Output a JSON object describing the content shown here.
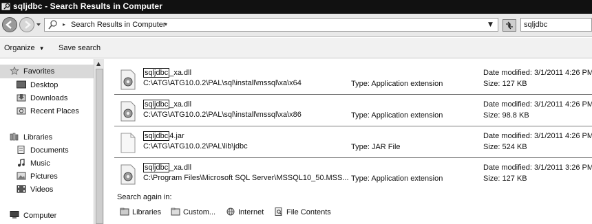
{
  "window": {
    "title": "sqljdbc - Search Results in Computer"
  },
  "address_bar": {
    "breadcrumb": "Search Results in Computer",
    "search_value": "sqljdbc"
  },
  "command_bar": {
    "organize_label": "Organize",
    "save_search_label": "Save search"
  },
  "navigation": {
    "favorites_label": "Favorites",
    "favorites_items": [
      "Desktop",
      "Downloads",
      "Recent Places"
    ],
    "libraries_label": "Libraries",
    "libraries_items": [
      "Documents",
      "Music",
      "Pictures",
      "Videos"
    ],
    "computer_label": "Computer"
  },
  "results": [
    {
      "name_match": "sqljdbc",
      "name_rest": "_xa.dll",
      "path": "C:\\ATG\\ATG10.0.2\\PAL\\sql\\install\\mssql\\xa\\x64",
      "type": "Type: Application extension",
      "date": "Date modified: 3/1/2011 4:26 PM",
      "size": "Size: 127 KB",
      "icon": "dll-gear-icon"
    },
    {
      "name_match": "sqljdbc",
      "name_rest": "_xa.dll",
      "path": "C:\\ATG\\ATG10.0.2\\PAL\\sql\\install\\mssql\\xa\\x86",
      "type": "Type: Application extension",
      "date": "Date modified: 3/1/2011 4:26 PM",
      "size": "Size: 98.8 KB",
      "icon": "dll-gear-icon"
    },
    {
      "name_match": "sqljdbc",
      "name_rest": "4.jar",
      "path": "C:\\ATG\\ATG10.0.2\\PAL\\lib\\jdbc",
      "type": "Type: JAR File",
      "date": "Date modified: 3/1/2011 4:26 PM",
      "size": "Size: 524 KB",
      "icon": "blank-file-icon"
    },
    {
      "name_match": "sqljdbc",
      "name_rest": "_xa.dll",
      "path": "C:\\Program Files\\Microsoft SQL Server\\MSSQL10_50.MSS...",
      "type": "Type: Application extension",
      "date": "Date modified: 3/1/2011 3:26 PM",
      "size": "Size: 127 KB",
      "icon": "dll-gear-icon"
    }
  ],
  "search_again": {
    "label": "Search again in:",
    "options": [
      "Libraries",
      "Custom...",
      "Internet",
      "File Contents"
    ]
  }
}
